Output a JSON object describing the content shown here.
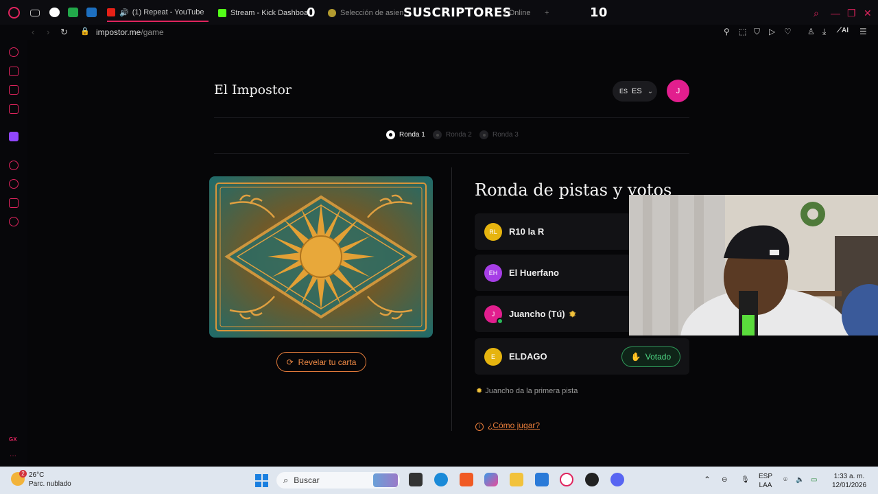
{
  "browser": {
    "tabs": [
      {
        "label": "(1) Repeat - YouTube",
        "active": true
      },
      {
        "label": "Stream - Kick Dashboard",
        "active": false
      },
      {
        "label": "Selección de asiento",
        "active": false
      },
      {
        "label": "r Online",
        "active": false
      }
    ],
    "new_tab": "+",
    "url_host": "impostor.me",
    "url_path": "/game"
  },
  "stream_overlay": {
    "left_count": "0",
    "label": "SUSCRIPTORES",
    "right_count": "10"
  },
  "game": {
    "title": "El Impostor",
    "lang_flag": "ES",
    "lang_label": "ES",
    "user_initial": "J",
    "rounds": [
      {
        "label": "Ronda 1",
        "active": true
      },
      {
        "label": "Ronda 2",
        "active": false
      },
      {
        "label": "Ronda 3",
        "active": false
      }
    ],
    "reveal_button": "Revelar tu carta",
    "section_title": "Ronda de pistas y votos",
    "players": [
      {
        "initials": "RL",
        "name": "R10 la R",
        "color": "#e6b40f"
      },
      {
        "initials": "EH",
        "name": "El Huerfano",
        "color": "#a63ee6"
      },
      {
        "initials": "J",
        "name": "Juancho (Tú)",
        "color": "#e21e8e"
      },
      {
        "initials": "E",
        "name": "ELDAGO",
        "color": "#e6b40f"
      }
    ],
    "voted_label": "Votado",
    "hint_text": "Juancho da la primera pista",
    "how_to_play": "¿Cómo jugar?"
  },
  "taskbar": {
    "weather_alerts": "2",
    "temperature": "26°C",
    "weather_desc": "Parc. nublado",
    "search_label": "Buscar",
    "lang_line1": "ESP",
    "lang_line2": "LAA",
    "time": "1:33 a. m.",
    "date": "12/01/2026"
  },
  "colors": {
    "accent": "#e0245e",
    "orange": "#e87d3a",
    "green": "#2f9a5a"
  }
}
